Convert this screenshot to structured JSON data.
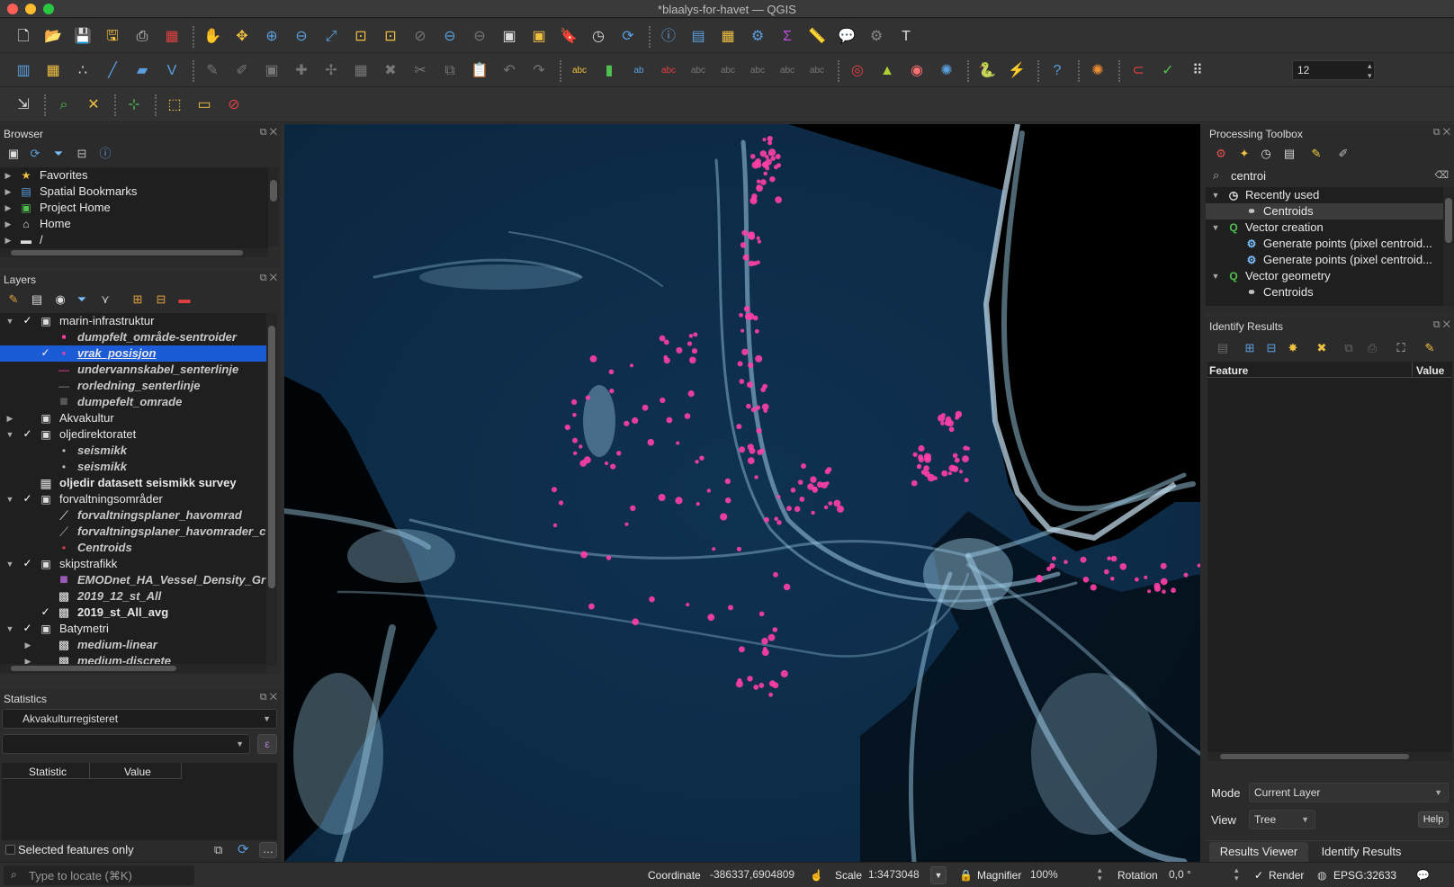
{
  "window": {
    "title": "*blaalys-for-havet — QGIS"
  },
  "browser": {
    "title": "Browser",
    "items": [
      {
        "label": "Favorites",
        "icon": "star-icon"
      },
      {
        "label": "Spatial Bookmarks",
        "icon": "bookmark-icon"
      },
      {
        "label": "Project Home",
        "icon": "project-home-icon"
      },
      {
        "label": "Home",
        "icon": "home-icon"
      },
      {
        "label": "/",
        "icon": "folder-icon"
      }
    ]
  },
  "layers": {
    "title": "Layers",
    "rows": [
      {
        "label": "marin-infrastruktur",
        "style": "normal",
        "checked": true,
        "expanded": true,
        "level": 0,
        "group": true
      },
      {
        "label": "dumpfelt_område-sentroider",
        "style": "italic",
        "checked": false,
        "level": 1,
        "sym": "square-pink"
      },
      {
        "label": "vrak_posisjon",
        "style": "selected",
        "checked": true,
        "level": 1,
        "sym": "dot-pink"
      },
      {
        "label": "undervannskabel_senterlinje",
        "style": "italic",
        "checked": false,
        "level": 1,
        "sym": "line-pink"
      },
      {
        "label": "rorledning_senterlinje",
        "style": "italic",
        "checked": false,
        "level": 1,
        "sym": "line-gray"
      },
      {
        "label": "dumpefelt_omrade",
        "style": "italic",
        "checked": false,
        "level": 1,
        "sym": "box-gray"
      },
      {
        "label": "Akvakultur",
        "style": "normal",
        "checked": false,
        "expanded": false,
        "level": 0,
        "group": true
      },
      {
        "label": "oljedirektoratet",
        "style": "normal",
        "checked": true,
        "expanded": true,
        "level": 0,
        "group": true
      },
      {
        "label": "seismikk",
        "style": "italic",
        "checked": false,
        "level": 1,
        "sym": "dot-gray"
      },
      {
        "label": "seismikk",
        "style": "italic",
        "checked": false,
        "level": 1,
        "sym": "dot-gray"
      },
      {
        "label": "oljedir datasett seismikk survey",
        "style": "bold",
        "checked": false,
        "level": 0,
        "sym": "table"
      },
      {
        "label": "forvaltningsområder",
        "style": "normal",
        "checked": true,
        "expanded": true,
        "level": 0,
        "group": true
      },
      {
        "label": "forvaltningsplaner_havomrad",
        "style": "italic",
        "checked": false,
        "level": 1,
        "sym": "hatch"
      },
      {
        "label": "forvaltningsplaner_havomrader_c",
        "style": "italic",
        "checked": false,
        "level": 1,
        "sym": "diag"
      },
      {
        "label": "Centroids",
        "style": "italic",
        "checked": false,
        "level": 1,
        "sym": "dot-red"
      },
      {
        "label": "skipstrafikk",
        "style": "normal",
        "checked": true,
        "expanded": true,
        "level": 0,
        "group": true
      },
      {
        "label": "EMODnet_HA_Vessel_Density_Gr",
        "style": "italic",
        "checked": false,
        "level": 1,
        "sym": "box-purple"
      },
      {
        "label": "2019_12_st_All",
        "style": "italic",
        "checked": false,
        "level": 1,
        "sym": "raster"
      },
      {
        "label": "2019_st_All_avg",
        "style": "bold",
        "checked": true,
        "level": 1,
        "sym": "raster"
      },
      {
        "label": "Batymetri",
        "style": "normal",
        "checked": true,
        "expanded": true,
        "level": 0,
        "group": true
      },
      {
        "label": "medium-linear",
        "style": "italic",
        "checked": false,
        "level": 1,
        "sym": "raster",
        "collapsed": true
      },
      {
        "label": "medium-discrete",
        "style": "italic",
        "checked": false,
        "level": 1,
        "sym": "raster",
        "collapsed": true
      }
    ]
  },
  "statistics": {
    "title": "Statistics",
    "layer": "Akvakulturregisteret",
    "field": "",
    "col_statistic": "Statistic",
    "col_value": "Value",
    "selected_only": "Selected features only"
  },
  "toolbox": {
    "title": "Processing Toolbox",
    "search": "centroi",
    "rows": [
      {
        "label": "Recently used",
        "level": 0,
        "icon": "clock-icon"
      },
      {
        "label": "Centroids",
        "level": 1,
        "icon": "centroids-icon",
        "selected": true
      },
      {
        "label": "Vector creation",
        "level": 0,
        "icon": "qgis-icon"
      },
      {
        "label": "Generate points (pixel centroid...",
        "level": 1,
        "icon": "gear-icon"
      },
      {
        "label": "Generate points (pixel centroid...",
        "level": 1,
        "icon": "gear-icon"
      },
      {
        "label": "Vector geometry",
        "level": 0,
        "icon": "qgis-icon"
      },
      {
        "label": "Centroids",
        "level": 1,
        "icon": "centroids-icon"
      }
    ]
  },
  "identify": {
    "title": "Identify Results",
    "col_feature": "Feature",
    "col_value": "Value",
    "mode_label": "Mode",
    "mode_value": "Current Layer",
    "view_label": "View",
    "view_value": "Tree",
    "help": "Help",
    "tab_viewer": "Results Viewer",
    "tab_identify": "Identify Results"
  },
  "toolbar": {
    "snap_tolerance": "12"
  },
  "status": {
    "locate_placeholder": "Type to locate (⌘K)",
    "coord_label": "Coordinate",
    "coord_value": "-386337,6904809",
    "scale_label": "Scale",
    "scale_value": "1:3473048",
    "magnifier_label": "Magnifier",
    "magnifier_value": "100%",
    "rotation_label": "Rotation",
    "rotation_value": "0,0 °",
    "render_label": "Render",
    "crs": "EPSG:32633"
  },
  "colors": {
    "accent": "#1c5bd6",
    "wreck": "#ff3fa8",
    "traffic": "#9ecbe6",
    "sea": "#0d2a44"
  }
}
